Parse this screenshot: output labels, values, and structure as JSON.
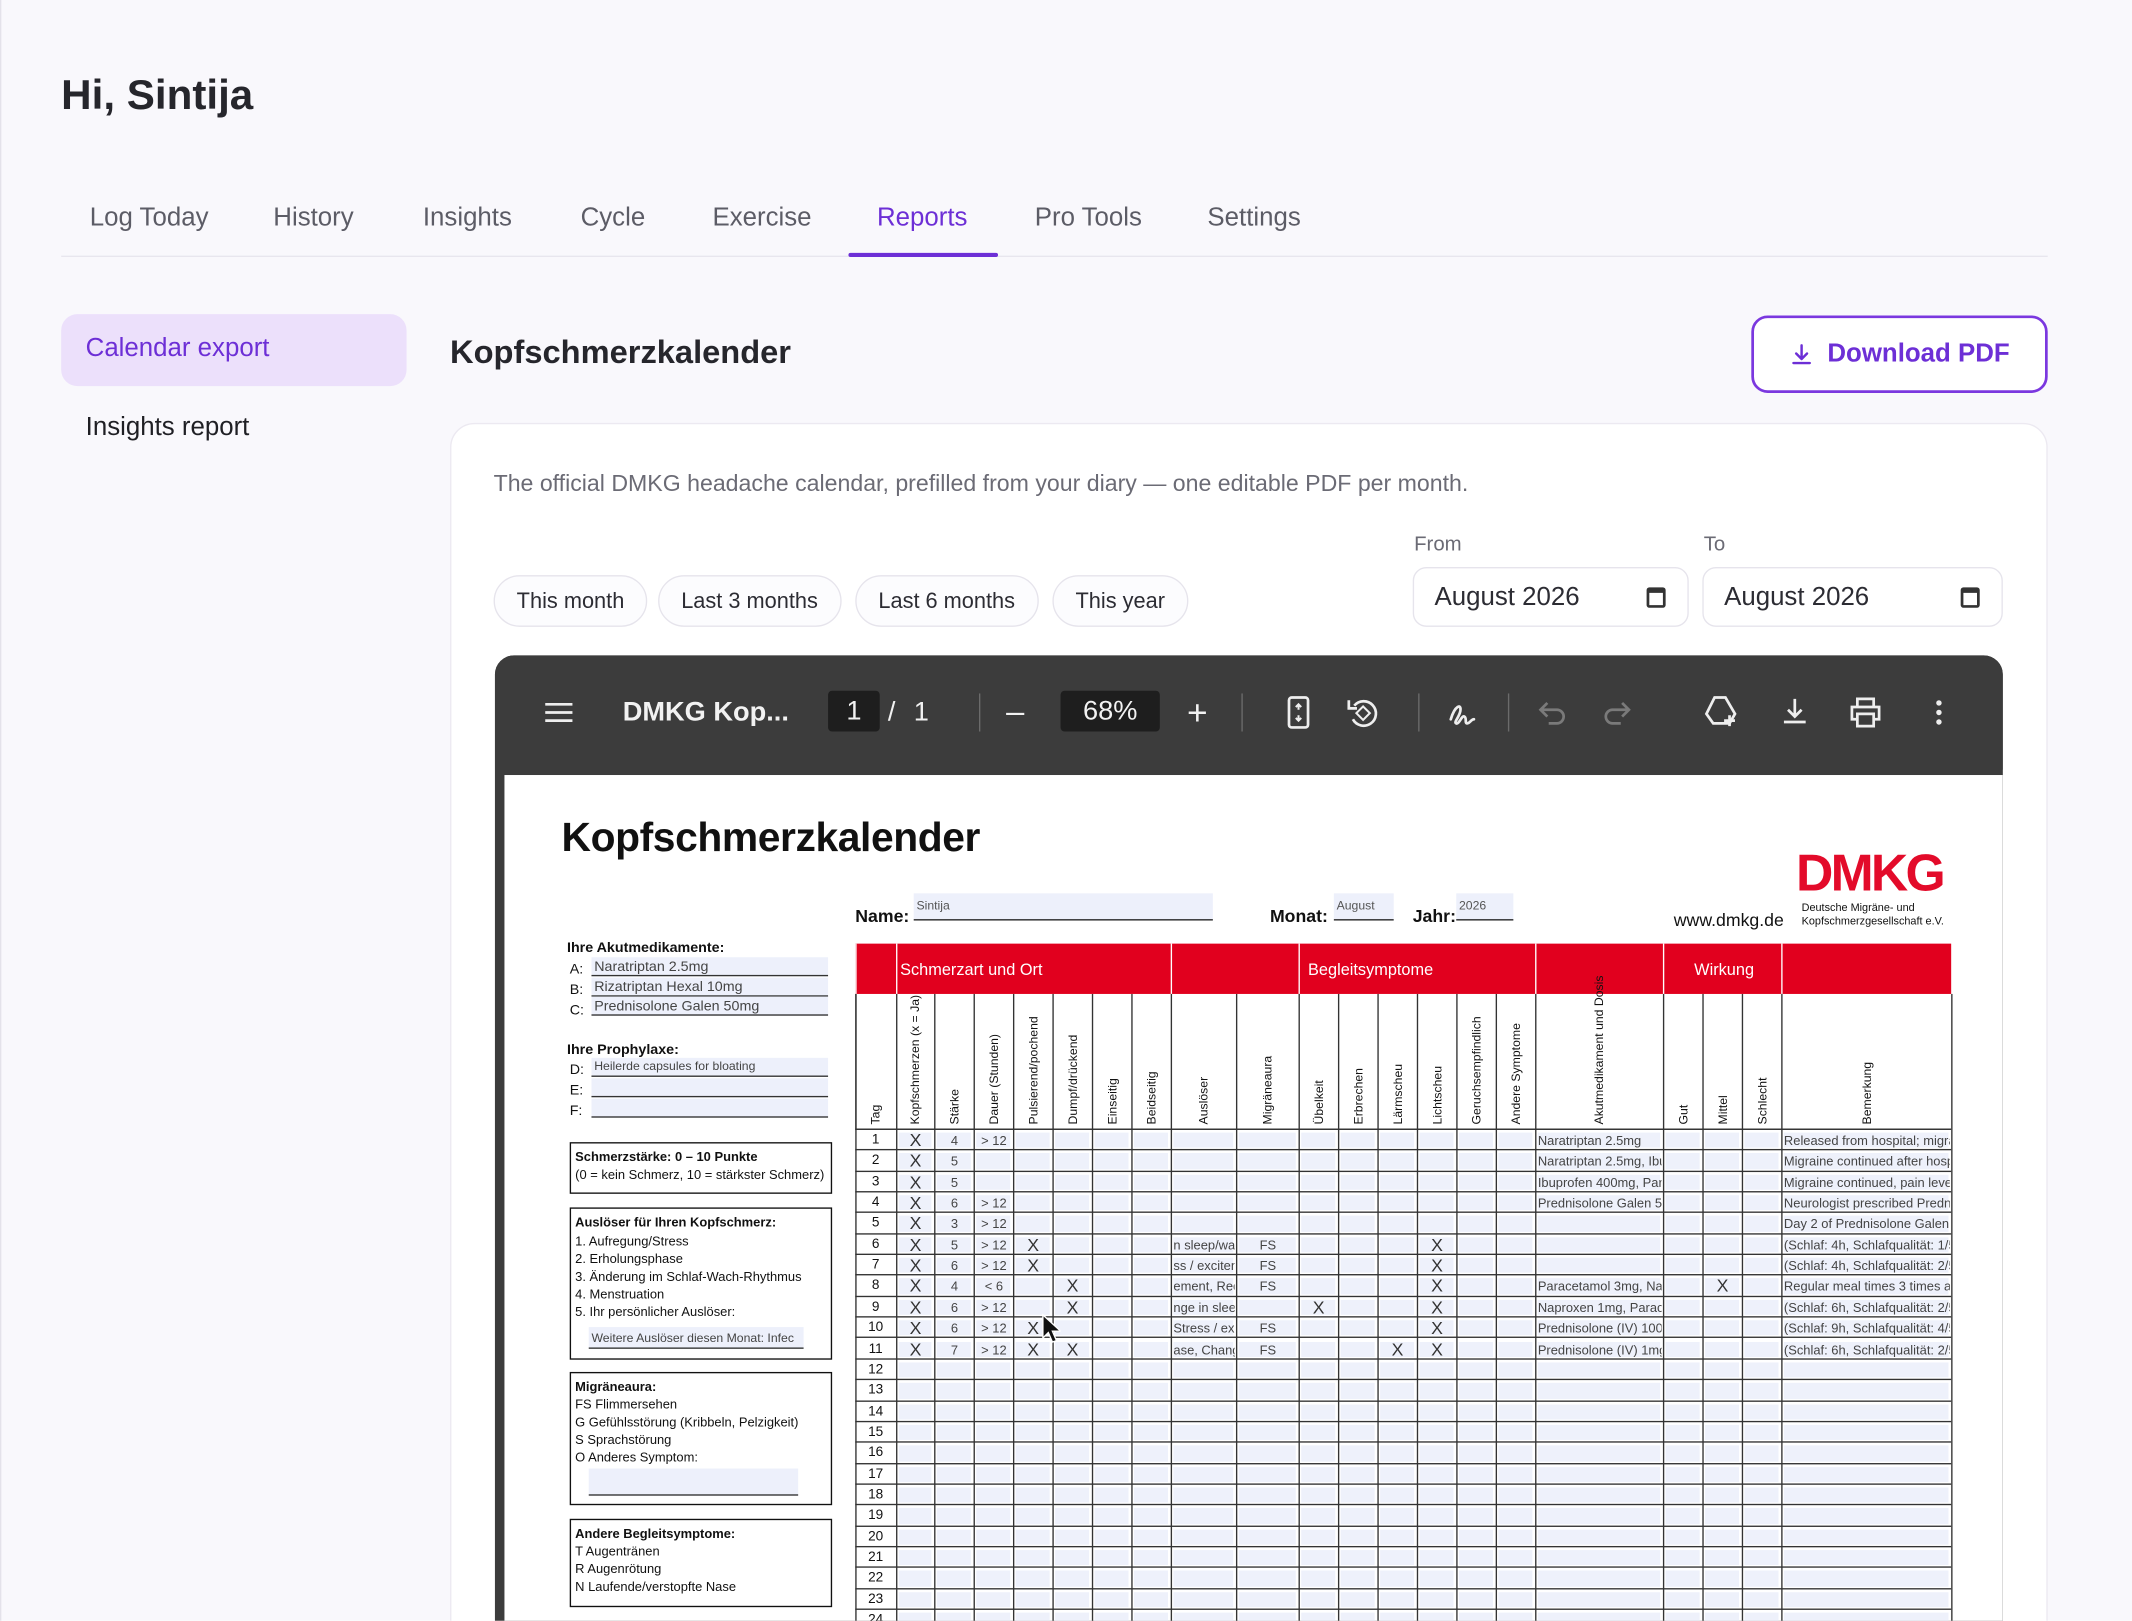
{
  "greeting": "Hi, Sintija",
  "tabs": [
    {
      "label": "Log Today"
    },
    {
      "label": "History"
    },
    {
      "label": "Insights"
    },
    {
      "label": "Cycle"
    },
    {
      "label": "Exercise"
    },
    {
      "label": "Reports",
      "active": true
    },
    {
      "label": "Pro Tools"
    },
    {
      "label": "Settings"
    }
  ],
  "sidebar": {
    "items": [
      {
        "label": "Calendar export",
        "active": true
      },
      {
        "label": "Insights report"
      }
    ]
  },
  "panel": {
    "title": "Kopfschmerzkalender",
    "download_label": "Download PDF",
    "description": "The official DMKG headache calendar, prefilled from your diary — one editable PDF per month.",
    "presets": [
      "This month",
      "Last 3 months",
      "Last 6 months",
      "This year"
    ],
    "from_label": "From",
    "to_label": "To",
    "from_value": "August 2026",
    "to_value": "August 2026"
  },
  "viewer": {
    "doc_title": "DMKG Kop...",
    "page_current": "1",
    "page_sep": "/",
    "page_total": "1",
    "zoom": "68%",
    "minus": "–",
    "plus": "+",
    "icons": [
      "menu-icon",
      "fit-page-icon",
      "rotate-icon",
      "sign-icon",
      "undo-icon",
      "redo-icon",
      "drive-icon",
      "download-icon",
      "print-icon",
      "more-icon"
    ]
  },
  "pdf": {
    "title": "Kopfschmerzkalender",
    "name_label": "Name:",
    "name_value": "Sintija",
    "month_label": "Monat:",
    "month_value": "August",
    "year_label": "Jahr:",
    "year_value": "2026",
    "website": "www.dmkg.de",
    "logo": "DMKG",
    "logo_sub1": "Deutsche Migräne- und",
    "logo_sub2": "Kopfschmerzgesellschaft e.V.",
    "acute_label": "Ihre Akutmedikamente:",
    "acute": [
      {
        "k": "A:",
        "v": "Naratriptan 2.5mg"
      },
      {
        "k": "B:",
        "v": "Rizatriptan Hexal 10mg"
      },
      {
        "k": "C:",
        "v": "Prednisolone Galen 50mg"
      }
    ],
    "proph_label": "Ihre Prophylaxe:",
    "proph": [
      {
        "k": "D:",
        "v": "Heilerde capsules for bloating"
      },
      {
        "k": "E:",
        "v": ""
      },
      {
        "k": "F:",
        "v": ""
      }
    ],
    "pain_title": "Schmerzstärke: 0 – 10 Punkte",
    "pain_sub": "(0 = kein Schmerz, 10 = stärkster Schmerz)",
    "trigger_title": "Auslöser für Ihren Kopfschmerz:",
    "triggers": [
      "1.  Aufregung/Stress",
      "2.  Erholungsphase",
      "3.  Änderung im Schlaf-Wach-Rhythmus",
      "4.  Menstruation",
      "5.  Ihr persönlicher Auslöser:"
    ],
    "trigger_more": "Weitere Auslöser diesen Monat: Infec",
    "aura_title": "Migräneaura:",
    "aura": [
      "FS Flimmersehen",
      "G  Gefühlsstörung (Kribbeln, Pelzigkeit)",
      "S  Sprachstörung",
      "O  Anderes Symptom:"
    ],
    "other_title": "Andere Begleitsymptome:",
    "other": [
      "T  Augentränen",
      "R  Augenrötung",
      "N  Laufende/verstopfte Nase"
    ],
    "sections": [
      "Schmerzart und Ort",
      "Begleitsymptome",
      "Wirkung"
    ],
    "col_headers": [
      "Tag",
      "Kopfschmerzen (x = Ja)",
      "Stärke",
      "Dauer (Stunden)",
      "Pulsierend/pochend",
      "Dumpf/drückend",
      "Einseitig",
      "Beidseitig",
      "Auslöser",
      "Migräneaura",
      "Übelkeit",
      "Erbrechen",
      "Lärmscheu",
      "Lichtscheu",
      "Geruchsempfindlich",
      "Andere Symptome",
      "Akutmedikament und Dosis",
      "Gut",
      "Mittel",
      "Schlecht",
      "Bemerkung"
    ],
    "rows": [
      {
        "day": "1",
        "ks": "X",
        "st": "4",
        "du": "> 12",
        "pu": "",
        "dp": "",
        "tr": "",
        "au": "",
        "ub": "",
        "la": "",
        "li": "",
        "med": "Naratriptan 2.5mg",
        "mi": "",
        "note": "Released from hospital; migra"
      },
      {
        "day": "2",
        "ks": "X",
        "st": "5",
        "du": "",
        "pu": "",
        "dp": "",
        "tr": "",
        "au": "",
        "ub": "",
        "la": "",
        "li": "",
        "med": "Naratriptan 2.5mg, Ibu",
        "mi": "",
        "note": "Migraine continued after hosp"
      },
      {
        "day": "3",
        "ks": "X",
        "st": "5",
        "du": "",
        "pu": "",
        "dp": "",
        "tr": "",
        "au": "",
        "ub": "",
        "la": "",
        "li": "",
        "med": "Ibuprofen 400mg, Para",
        "mi": "",
        "note": "Migraine continued, pain leve"
      },
      {
        "day": "4",
        "ks": "X",
        "st": "6",
        "du": "> 12",
        "pu": "",
        "dp": "",
        "tr": "",
        "au": "",
        "ub": "",
        "la": "",
        "li": "",
        "med": "Prednisolone Galen 50",
        "mi": "",
        "note": "Neurologist prescribed Predn"
      },
      {
        "day": "5",
        "ks": "X",
        "st": "3",
        "du": "> 12",
        "pu": "",
        "dp": "",
        "tr": "",
        "au": "",
        "ub": "",
        "la": "",
        "li": "",
        "med": "",
        "mi": "",
        "note": "Day 2 of Prednisolone Galen,"
      },
      {
        "day": "6",
        "ks": "X",
        "st": "5",
        "du": "> 12",
        "pu": "X",
        "dp": "",
        "tr": "n sleep/wak",
        "au": "FS",
        "ub": "",
        "la": "",
        "li": "X",
        "med": "",
        "mi": "",
        "note": "(Schlaf: 4h, Schlafqualität: 1/5"
      },
      {
        "day": "7",
        "ks": "X",
        "st": "6",
        "du": "> 12",
        "pu": "X",
        "dp": "",
        "tr": "ss / exciten",
        "au": "FS",
        "ub": "",
        "la": "",
        "li": "X",
        "med": "",
        "mi": "",
        "note": "(Schlaf: 4h, Schlafqualität: 2/5"
      },
      {
        "day": "8",
        "ks": "X",
        "st": "4",
        "du": "< 6",
        "pu": "",
        "dp": "X",
        "tr": "ement, Rec",
        "au": "FS",
        "ub": "",
        "la": "",
        "li": "X",
        "med": "Paracetamol 3mg, Nap",
        "mi": "X",
        "note": "Regular meal times 3 times a"
      },
      {
        "day": "9",
        "ks": "X",
        "st": "6",
        "du": "> 12",
        "pu": "",
        "dp": "X",
        "tr": "nge in slee",
        "au": "",
        "ub": "X",
        "la": "",
        "li": "X",
        "med": "Naproxen 1mg, Parace",
        "mi": "",
        "note": "(Schlaf: 6h, Schlafqualität: 2/5"
      },
      {
        "day": "10",
        "ks": "X",
        "st": "6",
        "du": "> 12",
        "pu": "X",
        "dp": "",
        "tr": "Stress / ex",
        "au": "FS",
        "ub": "",
        "la": "",
        "li": "X",
        "med": "Prednisolone (IV) 100r",
        "mi": "",
        "note": "(Schlaf: 9h, Schlafqualität: 4/5"
      },
      {
        "day": "11",
        "ks": "X",
        "st": "7",
        "du": "> 12",
        "pu": "X",
        "dp": "X",
        "tr": "ase, Chang",
        "au": "FS",
        "ub": "",
        "la": "X",
        "li": "X",
        "med": "Prednisolone (IV) 1mg",
        "mi": "",
        "note": "(Schlaf: 6h, Schlafqualität: 2/5"
      },
      {
        "day": "12"
      },
      {
        "day": "13"
      },
      {
        "day": "14"
      },
      {
        "day": "15"
      },
      {
        "day": "16"
      },
      {
        "day": "17"
      },
      {
        "day": "18"
      },
      {
        "day": "19"
      },
      {
        "day": "20"
      },
      {
        "day": "21"
      },
      {
        "day": "22"
      },
      {
        "day": "23"
      },
      {
        "day": "24"
      }
    ]
  }
}
